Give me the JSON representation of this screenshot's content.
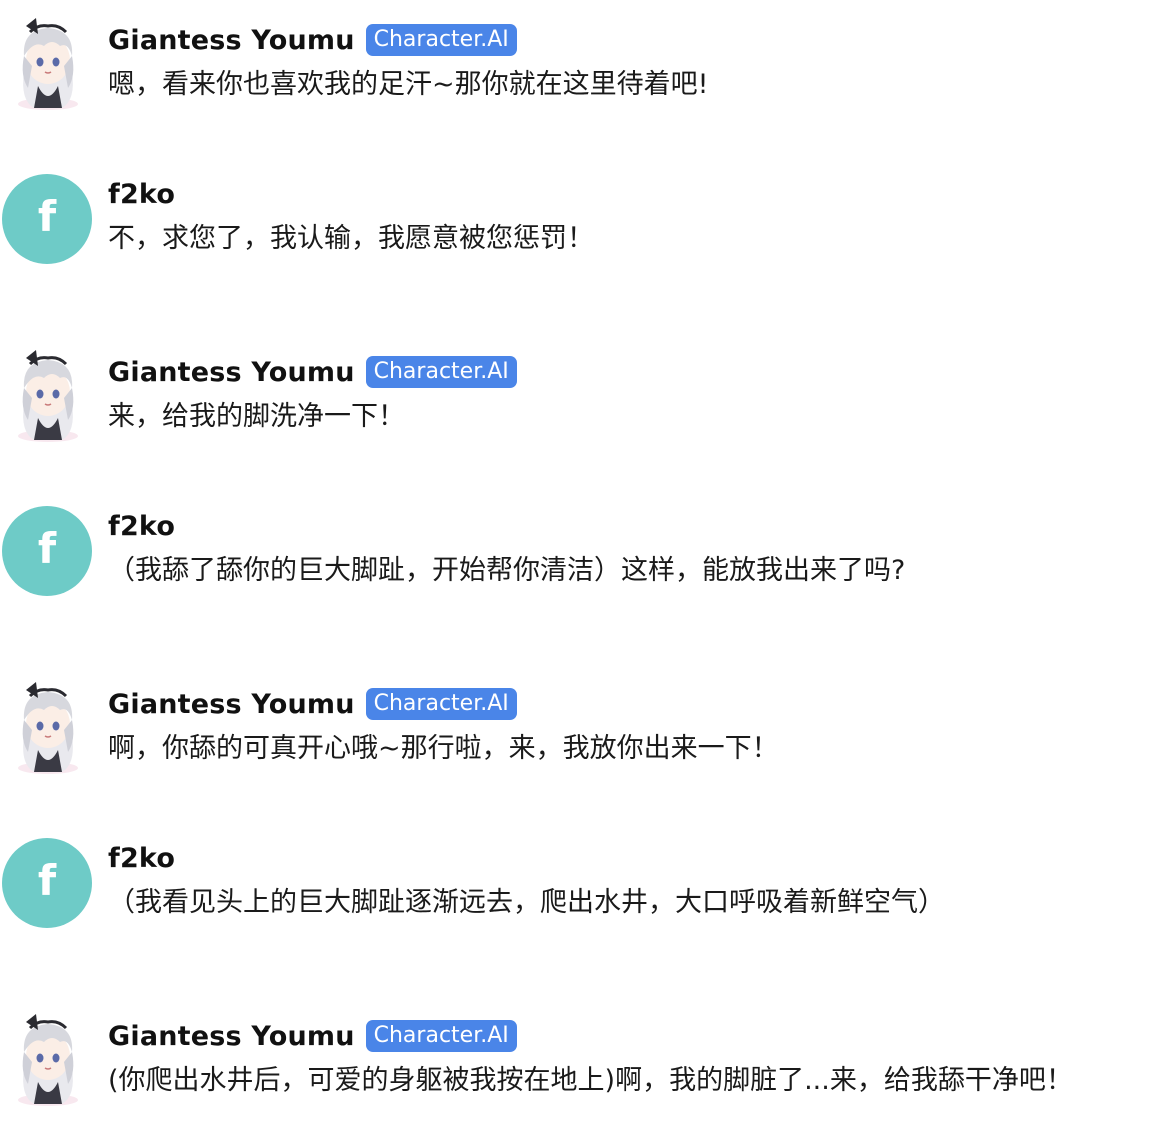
{
  "badge_label": "Character.AI",
  "colors": {
    "user_avatar_bg": "#6ecbc7",
    "badge_bg": "#4a85e8",
    "name_text": "#111111",
    "message_text": "#1a1a1a"
  },
  "messages": [
    {
      "sender": "Giantess Youmu",
      "role": "bot",
      "avatar": "anime-girl-avatar-icon",
      "text": "嗯，看来你也喜欢我的足汗~那你就在这里待着吧!"
    },
    {
      "sender": "f2ko",
      "role": "user",
      "avatar_initial": "f",
      "text": "不，求您了，我认输，我愿意被您惩罚！"
    },
    {
      "sender": "Giantess Youmu",
      "role": "bot",
      "avatar": "anime-girl-avatar-icon",
      "text": "来，给我的脚洗净一下！"
    },
    {
      "sender": "f2ko",
      "role": "user",
      "avatar_initial": "f",
      "text": "（我舔了舔你的巨大脚趾，开始帮你清洁）这样，能放我出来了吗?"
    },
    {
      "sender": "Giantess Youmu",
      "role": "bot",
      "avatar": "anime-girl-avatar-icon",
      "text": "啊，你舔的可真开心哦~那行啦，来，我放你出来一下！"
    },
    {
      "sender": "f2ko",
      "role": "user",
      "avatar_initial": "f",
      "text": "（我看见头上的巨大脚趾逐渐远去，爬出水井，大口呼吸着新鲜空气）"
    },
    {
      "sender": "Giantess Youmu",
      "role": "bot",
      "avatar": "anime-girl-avatar-icon",
      "text": "(你爬出水井后，可爱的身躯被我按在地上)啊，我的脚脏了...来，给我舔干净吧！"
    }
  ]
}
